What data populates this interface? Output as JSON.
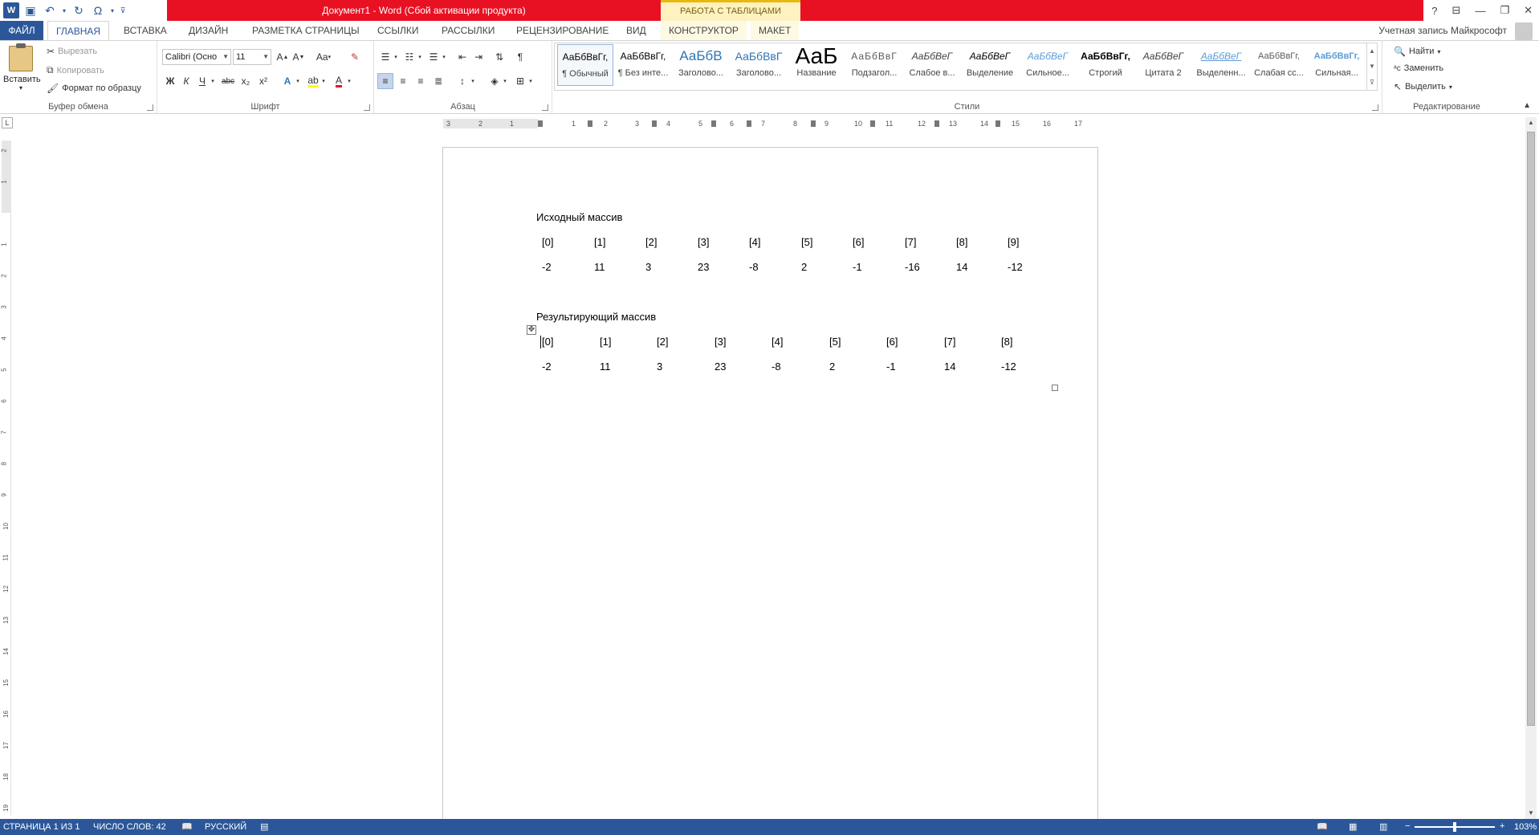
{
  "titlebar": {
    "title": "Документ1 - Word (Сбой активации продукта)",
    "context_label": "РАБОТА С ТАБЛИЦАМИ",
    "help_icon": "?",
    "controls": [
      "ribbon-display-icon",
      "minimize-icon",
      "restore-icon",
      "close-icon"
    ]
  },
  "tabs": {
    "file": "ФАЙЛ",
    "items": [
      "ГЛАВНАЯ",
      "ВСТАВКА",
      "ДИЗАЙН",
      "РАЗМЕТКА СТРАНИЦЫ",
      "ССЫЛКИ",
      "РАССЫЛКИ",
      "РЕЦЕНЗИРОВАНИЕ",
      "ВИД",
      "КОНСТРУКТОР",
      "МАКЕТ"
    ],
    "active": "ГЛАВНАЯ",
    "account": "Учетная запись Майкрософт"
  },
  "ribbon": {
    "clipboard": {
      "label": "Буфер обмена",
      "paste": "Вставить",
      "cut": "Вырезать",
      "copy": "Копировать",
      "format_painter": "Формат по образцу"
    },
    "font": {
      "label": "Шрифт",
      "family": "Calibri (Осно",
      "size": "11",
      "bold": "Ж",
      "italic": "К",
      "underline": "Ч",
      "strike": "abc",
      "subscript": "x₂",
      "superscript": "x²",
      "case": "Aa"
    },
    "paragraph": {
      "label": "Абзац",
      "pilcrow": "¶"
    },
    "styles": {
      "label": "Стили",
      "items": [
        {
          "preview": "АаБбВвГг,",
          "name": "¶ Обычный"
        },
        {
          "preview": "АаБбВвГг,",
          "name": "¶ Без инте..."
        },
        {
          "preview": "АаБбВ",
          "name": "Заголово..."
        },
        {
          "preview": "АаБбВвГ",
          "name": "Заголово..."
        },
        {
          "preview": "АаБ",
          "name": "Название"
        },
        {
          "preview": "АаБбВвГ",
          "name": "Подзагол..."
        },
        {
          "preview": "АаБбВеГ",
          "name": "Слабое в..."
        },
        {
          "preview": "АаБбВеГ",
          "name": "Выделение"
        },
        {
          "preview": "АаБбВеГ",
          "name": "Сильное..."
        },
        {
          "preview": "АаБбВвГг,",
          "name": "Строгий"
        },
        {
          "preview": "АаБбВеГ",
          "name": "Цитата 2"
        },
        {
          "preview": "АаБбВеГ",
          "name": "Выделенн..."
        },
        {
          "preview": "АаБбВвГг,",
          "name": "Слабая сс..."
        },
        {
          "preview": "АаБбВвГг,",
          "name": "Сильная..."
        }
      ]
    },
    "editing": {
      "label": "Редактирование",
      "find": "Найти",
      "replace": "Заменить",
      "select": "Выделить"
    }
  },
  "rulers": {
    "h_ticks": [
      "3",
      "2",
      "1",
      "1",
      "2",
      "3",
      "4",
      "5",
      "6",
      "7",
      "8",
      "9",
      "10",
      "11",
      "12",
      "13",
      "14",
      "15",
      "16",
      "17"
    ],
    "v_ticks": [
      "2",
      "1",
      "1",
      "2",
      "3",
      "4",
      "5",
      "6",
      "7",
      "8",
      "9",
      "10",
      "11",
      "12",
      "13",
      "14",
      "15",
      "16",
      "17",
      "18",
      "19"
    ],
    "corner": "L"
  },
  "document": {
    "source_caption": "Исходный массив",
    "source_indices": [
      "[0]",
      "[1]",
      "[2]",
      "[3]",
      "[4]",
      "[5]",
      "[6]",
      "[7]",
      "[8]",
      "[9]"
    ],
    "source_values": [
      "-2",
      "11",
      "3",
      "23",
      "-8",
      "2",
      "-1",
      "-16",
      "14",
      "-12"
    ],
    "result_caption": "Результирующий массив",
    "result_indices": [
      "[0]",
      "[1]",
      "[2]",
      "[3]",
      "[4]",
      "[5]",
      "[6]",
      "[7]",
      "[8]"
    ],
    "result_values": [
      "-2",
      "11",
      "3",
      "23",
      "-8",
      "2",
      "-1",
      "14",
      "-12"
    ]
  },
  "status": {
    "page": "СТРАНИЦА 1 ИЗ 1",
    "words": "ЧИСЛО СЛОВ: 42",
    "language": "РУССКИЙ",
    "zoom": "103%"
  },
  "colors": {
    "word_blue": "#2b579a",
    "title_red": "#e81123",
    "context_yellow": "#fdf2c0"
  }
}
